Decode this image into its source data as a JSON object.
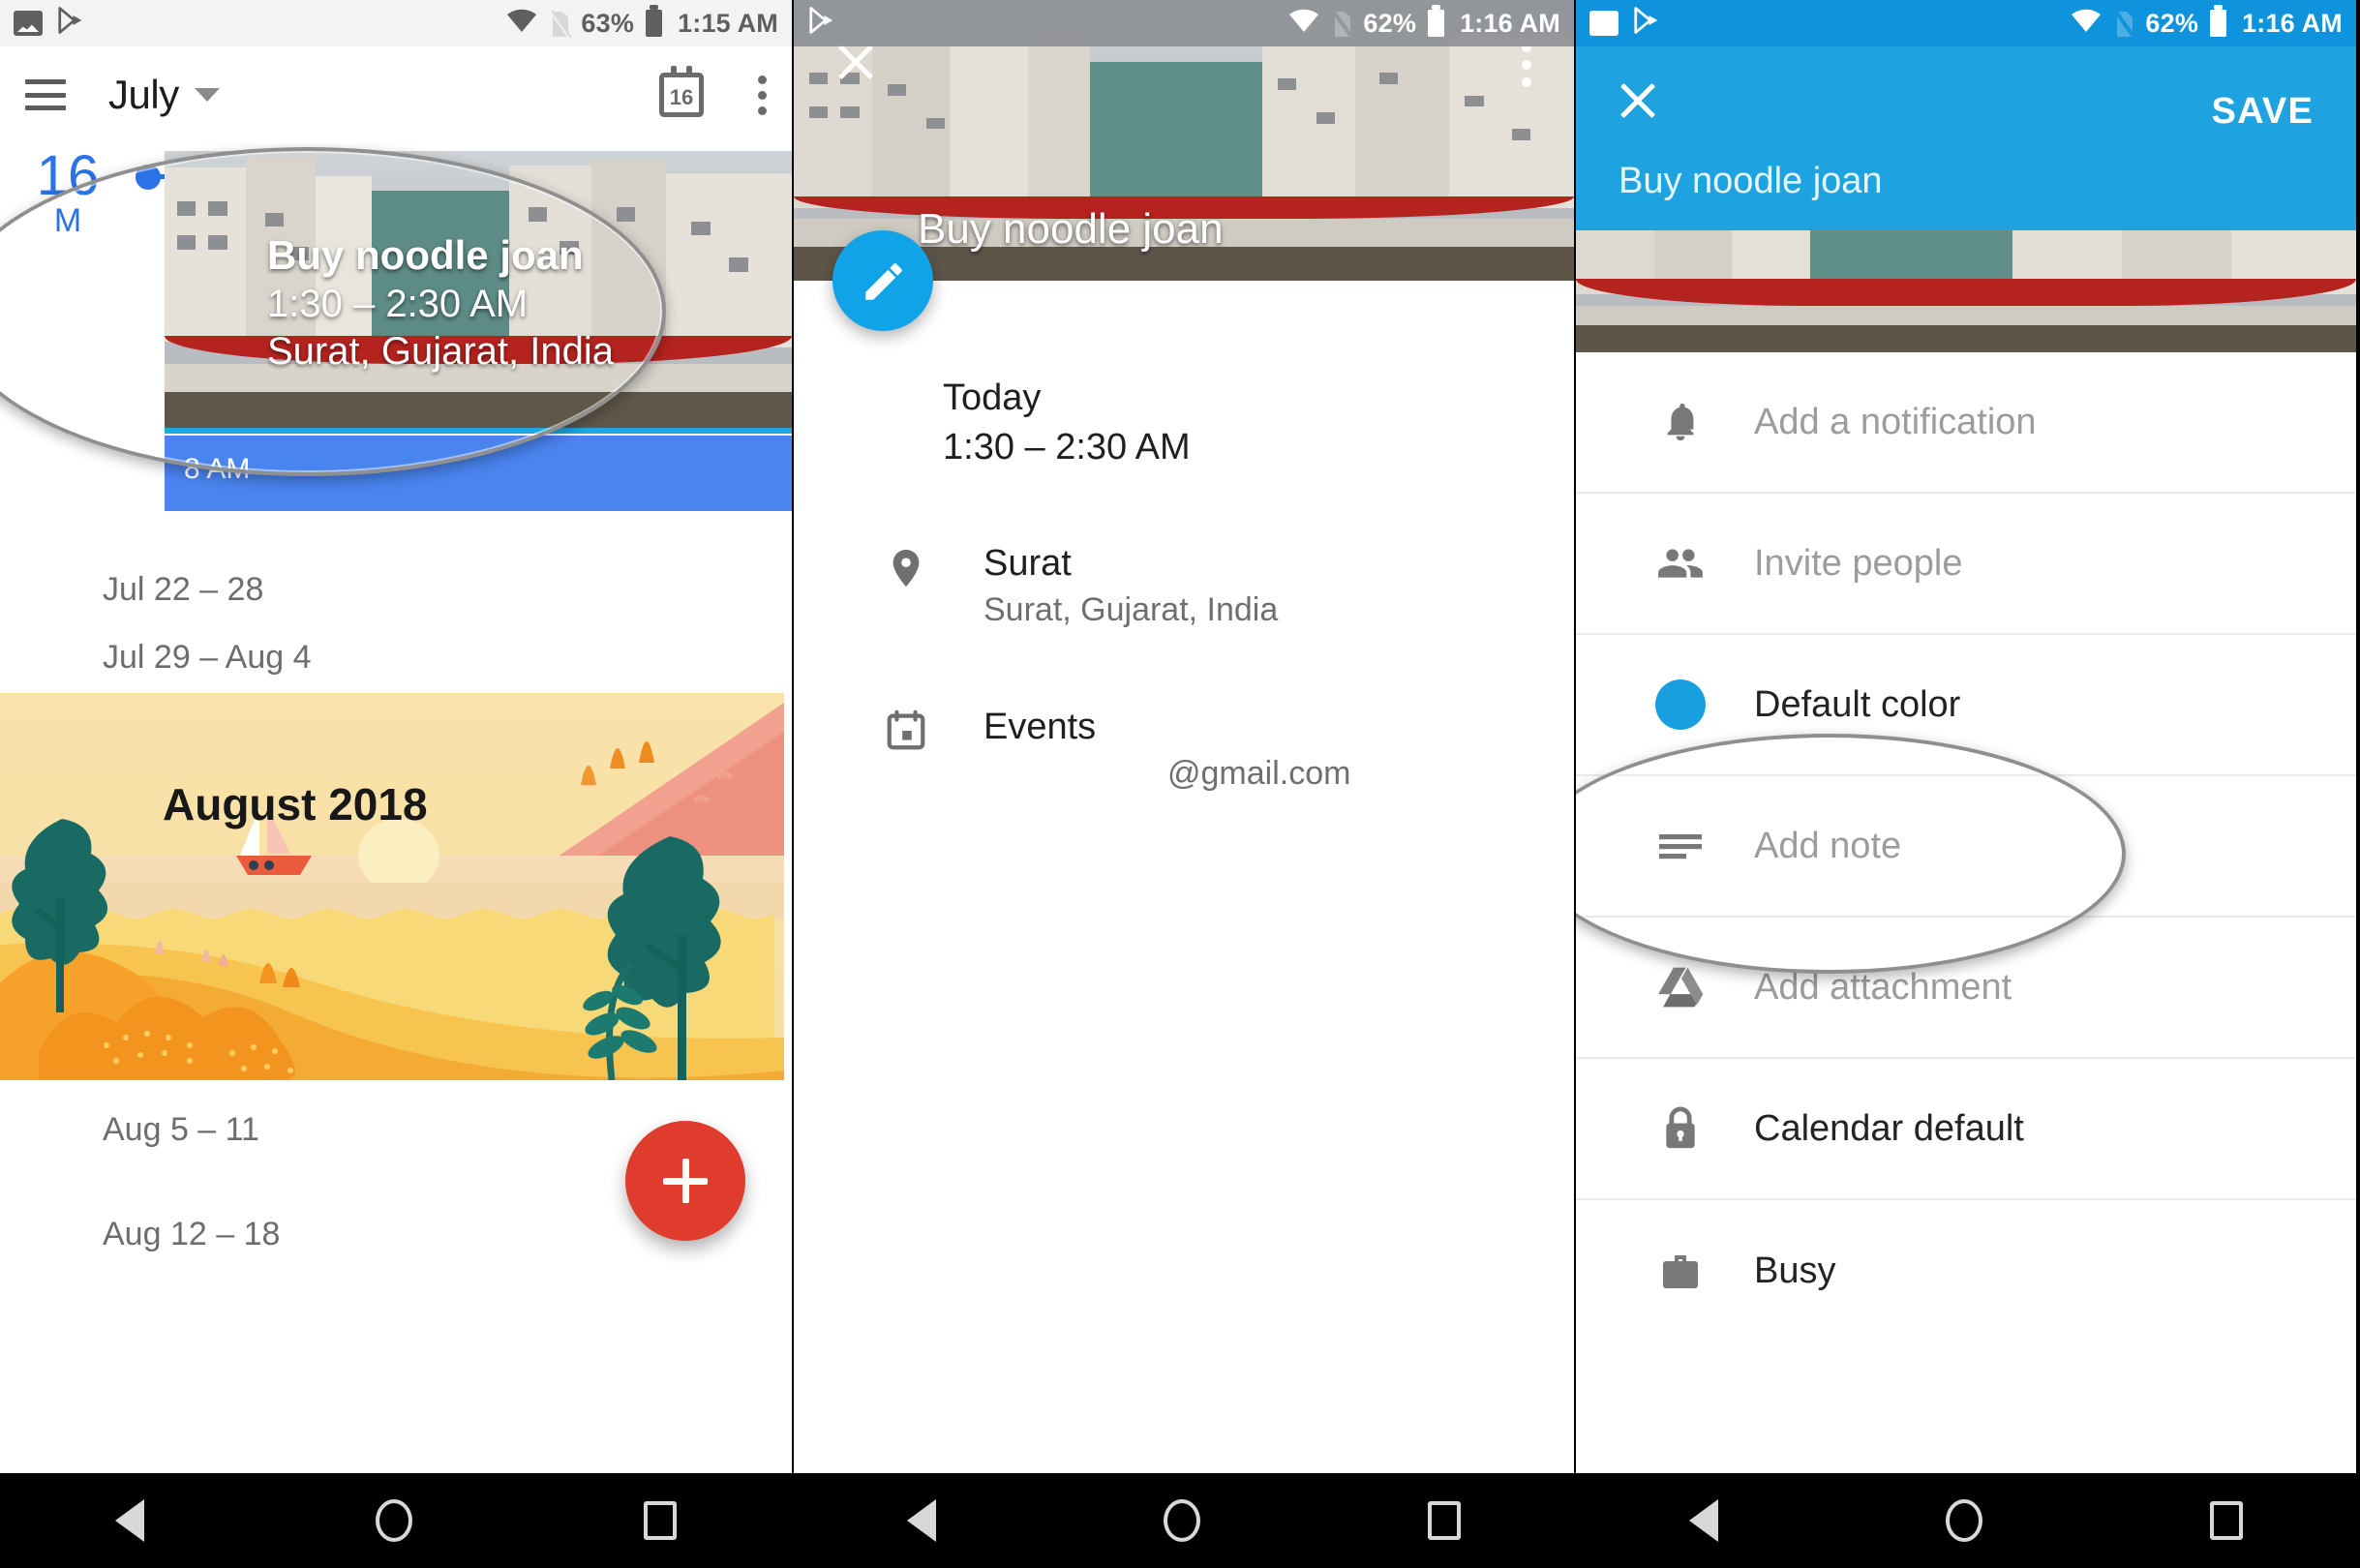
{
  "panel1": {
    "status": {
      "battery": "63%",
      "time": "1:15 AM",
      "icons": [
        "photo-icon",
        "play-store-icon",
        "wifi-icon",
        "sim-off-icon",
        "battery-icon"
      ]
    },
    "toolbar": {
      "title": "July",
      "menu_icon": "hamburger-icon",
      "dropdown_icon": "chevron-down-icon",
      "today_icon_label": "16",
      "overflow_icon": "kebab-icon"
    },
    "timeline": {
      "day_number": "16",
      "day_of_week": "M",
      "event": {
        "title": "Buy noodle joan",
        "time": "1:30 – 2:30 AM",
        "location": "Surat, Gujarat, India"
      },
      "hour_label": "8 AM"
    },
    "weeks": [
      "Jul 22 – 28",
      "Jul 29 – Aug 4",
      "Aug 5 – 11",
      "Aug 12 – 18"
    ],
    "month_banner": "August 2018",
    "fab_label": "+"
  },
  "panel2": {
    "status": {
      "battery": "62%",
      "time": "1:16 AM",
      "icons": [
        "play-store-icon",
        "wifi-icon",
        "sim-off-icon",
        "battery-icon"
      ]
    },
    "hero": {
      "close_icon": "close-icon",
      "overflow_icon": "kebab-icon",
      "title": "Buy noodle joan"
    },
    "edit_fab_icon": "pencil-icon",
    "details": {
      "date_label": "Today",
      "time_label": "1:30 – 2:30 AM",
      "location_icon": "location-pin-icon",
      "location_name": "Surat",
      "location_address": "Surat, Gujarat, India",
      "calendar_icon": "calendar-icon",
      "calendar_name": "Events",
      "calendar_account": "@gmail.com"
    }
  },
  "panel3": {
    "status": {
      "battery": "62%",
      "time": "1:16 AM",
      "icons": [
        "photo-icon",
        "play-store-icon",
        "wifi-icon",
        "sim-off-icon",
        "battery-icon"
      ]
    },
    "appbar": {
      "close_icon": "close-icon",
      "save_label": "SAVE",
      "title_value": "Buy noodle joan",
      "accent_color": "#1fa2e0"
    },
    "options": [
      {
        "icon": "bell-icon",
        "label": "Add a notification",
        "state": "placeholder"
      },
      {
        "icon": "people-icon",
        "label": "Invite people",
        "state": "placeholder"
      },
      {
        "icon": "color-dot-icon",
        "label": "Default color",
        "state": "value",
        "color": "#189fe0"
      },
      {
        "icon": "notes-icon",
        "label": "Add note",
        "state": "placeholder"
      },
      {
        "icon": "drive-icon",
        "label": "Add attachment",
        "state": "placeholder"
      },
      {
        "icon": "lock-icon",
        "label": "Calendar default",
        "state": "value"
      },
      {
        "icon": "briefcase-icon",
        "label": "Busy",
        "state": "value"
      }
    ]
  },
  "navbar": {
    "back_icon": "back-triangle-icon",
    "home_icon": "home-circle-icon",
    "recents_icon": "recents-square-icon"
  }
}
